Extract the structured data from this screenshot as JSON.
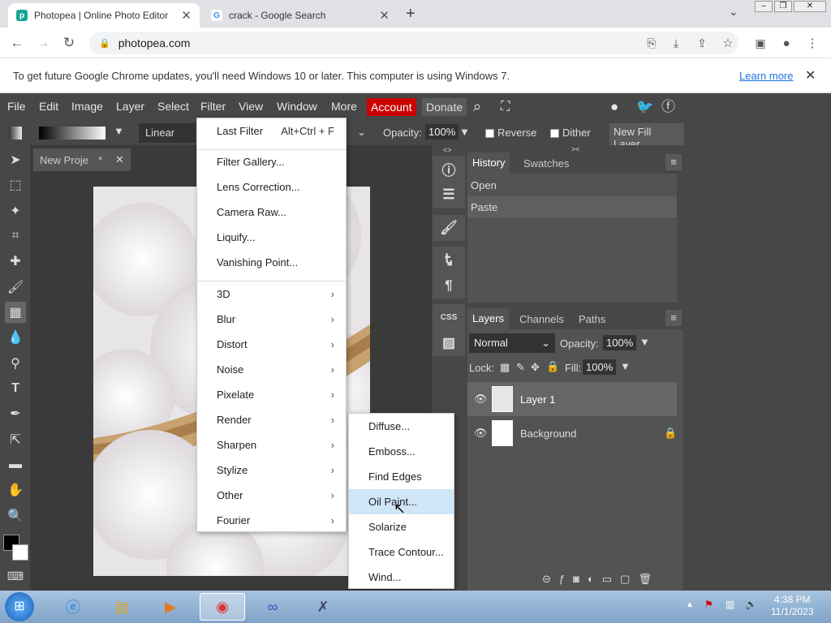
{
  "browser": {
    "tabs": [
      {
        "label": "Photopea | Online Photo Editor",
        "active": true
      },
      {
        "label": "crack - Google Search",
        "active": false
      }
    ],
    "new_tab": "+",
    "url": "photopea.com"
  },
  "notice": {
    "text": "To get future Google Chrome updates, you'll need Windows 10 or later. This computer is using Windows 7.",
    "link": "Learn more"
  },
  "menubar": {
    "items": [
      "File",
      "Edit",
      "Image",
      "Layer",
      "Select",
      "Filter",
      "View",
      "Window",
      "More"
    ],
    "account": "Account",
    "donate": "Donate"
  },
  "options": {
    "gradient_type": "Linear",
    "opacity_label": "Opacity:",
    "opacity_value": "100%",
    "reverse": "Reverse",
    "dither": "Dither",
    "new_fill_layer": "New Fill Layer"
  },
  "document": {
    "tab_label": "New Proje",
    "modified": "*"
  },
  "filter_menu": {
    "last_filter": "Last Filter",
    "last_filter_shortcut": "Alt+Ctrl + F",
    "group2": [
      "Filter Gallery...",
      "Lens Correction...",
      "Camera Raw...",
      "Liquify...",
      "Vanishing Point..."
    ],
    "submenus": [
      "3D",
      "Blur",
      "Distort",
      "Noise",
      "Pixelate",
      "Render",
      "Sharpen",
      "Stylize",
      "Other",
      "Fourier"
    ]
  },
  "stylize_menu": {
    "items": [
      "Diffuse...",
      "Emboss...",
      "Find Edges",
      "Oil Paint...",
      "Solarize",
      "Trace Contour...",
      "Wind..."
    ],
    "highlighted": "Oil Paint..."
  },
  "history": {
    "tabs": [
      "History",
      "Swatches"
    ],
    "items": [
      "Open",
      "Paste"
    ]
  },
  "layers": {
    "tabs": [
      "Layers",
      "Channels",
      "Paths"
    ],
    "blend_mode": "Normal",
    "opacity_label": "Opacity:",
    "opacity_value": "100%",
    "lock_label": "Lock:",
    "fill_label": "Fill:",
    "fill_value": "100%",
    "items": [
      "Layer 1",
      "Background"
    ]
  },
  "side_buttons": {
    "css": "CSS"
  },
  "taskbar": {
    "time": "4:38 PM",
    "date": "11/1/2023"
  }
}
